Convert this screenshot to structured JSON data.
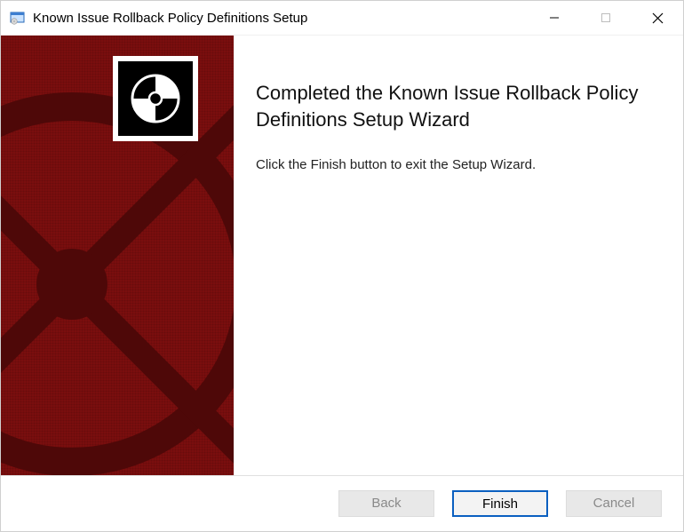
{
  "titlebar": {
    "title": "Known Issue Rollback Policy Definitions Setup"
  },
  "main": {
    "heading": "Completed the Known Issue Rollback Policy Definitions Setup Wizard",
    "message": "Click the Finish button to exit the Setup Wizard."
  },
  "footer": {
    "back": "Back",
    "finish": "Finish",
    "cancel": "Cancel"
  }
}
